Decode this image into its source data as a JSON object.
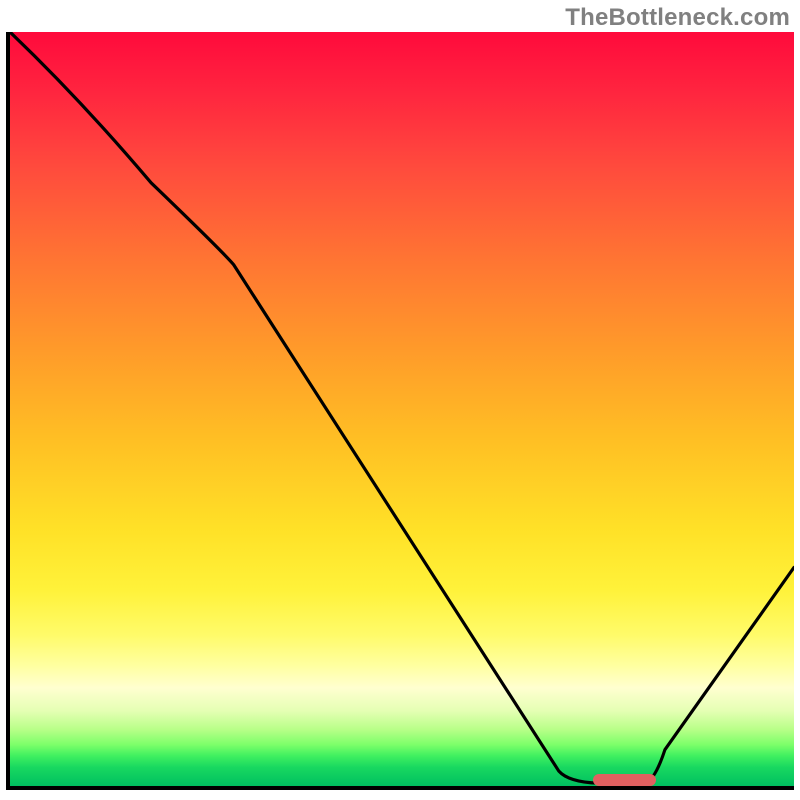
{
  "watermark": "TheBottleneck.com",
  "chart_data": {
    "type": "line",
    "title": "",
    "xlabel": "",
    "ylabel": "",
    "xlim": [
      0,
      100
    ],
    "ylim": [
      0,
      100
    ],
    "background": "red-yellow-green vertical gradient (high=red, low=green)",
    "series": [
      {
        "name": "bottleneck-curve",
        "x": [
          0,
          18,
          27,
          70,
          75,
          81,
          100
        ],
        "values": [
          100,
          80,
          71,
          2,
          0,
          0,
          29
        ]
      }
    ],
    "marker": {
      "name": "optimal-range",
      "x_start": 74,
      "x_end": 82,
      "y": 0,
      "color": "#e06060"
    },
    "gradient_stops": [
      {
        "pos": 0,
        "color": "#ff0a3c"
      },
      {
        "pos": 0.5,
        "color": "#ffd028"
      },
      {
        "pos": 0.85,
        "color": "#ffffc0"
      },
      {
        "pos": 1.0,
        "color": "#00c060"
      }
    ]
  }
}
